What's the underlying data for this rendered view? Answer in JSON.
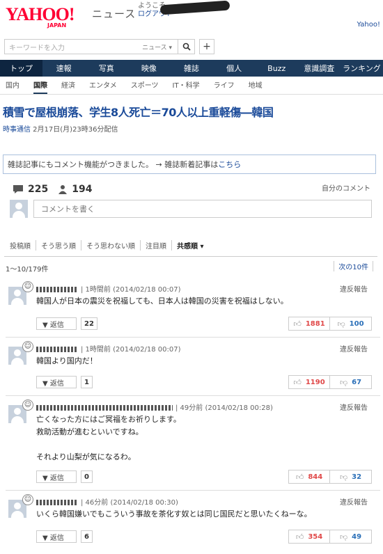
{
  "header": {
    "logo": "YAHOO!",
    "logo_sub": "JAPAN",
    "section": "ニュース",
    "welcome": "ようこそ",
    "logout": "ログアウト",
    "yahoo_link": "Yahoo!"
  },
  "search": {
    "placeholder": "キーワードを入力",
    "scope": "ニュース ▾",
    "search_icon": "search-icon",
    "plus_label": "+"
  },
  "nav": {
    "items": [
      "トップ",
      "速報",
      "写真",
      "映像",
      "雑誌",
      "個人",
      "Buzz",
      "意識調査",
      "ランキング"
    ]
  },
  "subnav": {
    "items": [
      "国内",
      "国際",
      "経済",
      "エンタメ",
      "スポーツ",
      "IT・科学",
      "ライフ",
      "地域"
    ]
  },
  "article": {
    "headline": "積雪で屋根崩落、学生8人死亡＝70人以上重軽傷―韓国",
    "publisher": "時事通信",
    "date": " 2月17日(月)23時36分配信"
  },
  "notice": {
    "text": "雑誌記事にもコメント機能がつきました。 → 雑誌新着記事は",
    "link": "こちら"
  },
  "stats": {
    "comments": "225",
    "users": "194",
    "my_comments": "自分のコメント"
  },
  "comment_box": {
    "placeholder": "コメントを書く"
  },
  "sort": {
    "items": [
      "投稿順",
      "そう思う順",
      "そう思わない順",
      "注目順",
      "共感順 ▾"
    ]
  },
  "pagination": {
    "range": "1〜10/179件",
    "next": "次の10件"
  },
  "comments": [
    {
      "meta": "| 1時間前 (2014/02/18 00:07)",
      "body": "韓国人が日本の震災を祝福しても、日本人は韓国の災害を祝福はしない。",
      "replies": "22",
      "likes": "1881",
      "dislikes": "100",
      "report": "違反報告",
      "reply_label": "▼ 返信"
    },
    {
      "meta": "| 1時間前 (2014/02/18 00:07)",
      "body": "韓国より国内だ！",
      "replies": "1",
      "likes": "1190",
      "dislikes": "67",
      "report": "違反報告",
      "reply_label": "▼ 返信"
    },
    {
      "meta": "| 49分前 (2014/02/18 00:28)",
      "body": "亡くなった方にはご冥福をお祈りします。\n救助活動が進むといいですね。\n\nそれより山梨が気になるわ。",
      "replies": "0",
      "likes": "844",
      "dislikes": "32",
      "report": "違反報告",
      "reply_label": "▼ 返信"
    },
    {
      "meta": "| 46分前 (2014/02/18 00:30)",
      "body": "いくら韓国嫌いでもこういう事故を茶化す奴とは同じ国民だと思いたくねーな。",
      "replies": "6",
      "likes": "354",
      "dislikes": "49",
      "report": "違反報告",
      "reply_label": "▼ 返信"
    }
  ]
}
